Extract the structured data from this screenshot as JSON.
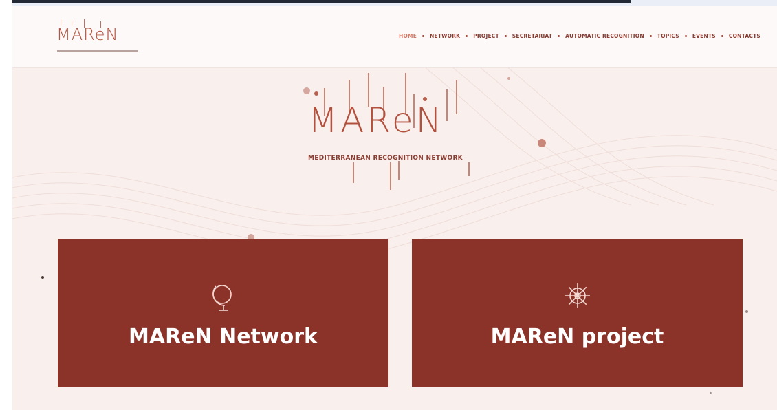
{
  "header": {
    "logo_text": "MAReN",
    "nav": [
      {
        "label": "HOME",
        "active": true
      },
      {
        "label": "NETWORK"
      },
      {
        "label": "PROJECT"
      },
      {
        "label": "SECRETARIAT"
      },
      {
        "label": "AUTOMATIC RECOGNITION"
      },
      {
        "label": "TOPICS"
      },
      {
        "label": "EVENTS"
      },
      {
        "label": "CONTACTS"
      }
    ]
  },
  "hero": {
    "logo_text": "MAReN",
    "subtitle": "MEDITERRANEAN RECOGNITION NETWORK"
  },
  "cards": [
    {
      "title": "MAReN Network",
      "icon": "globe-icon"
    },
    {
      "title": "MAReN project",
      "icon": "ship-wheel-icon"
    }
  ],
  "colors": {
    "brand": "#8c3329",
    "accent": "#b3513f",
    "background": "#f9efec"
  }
}
